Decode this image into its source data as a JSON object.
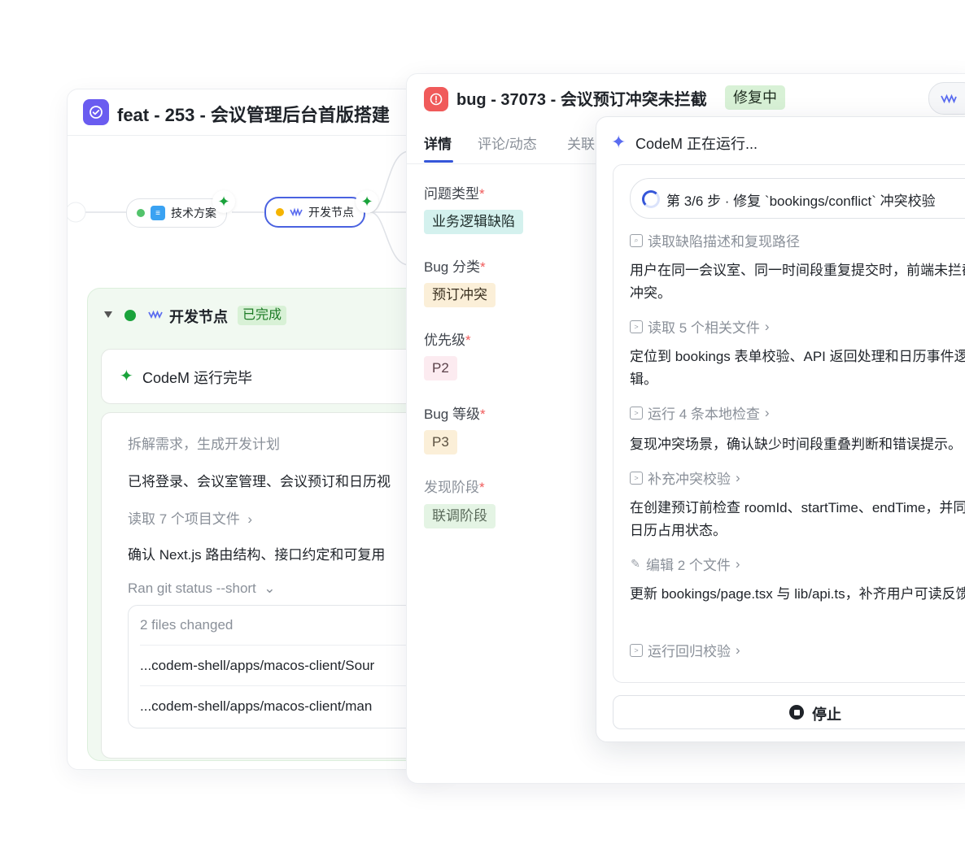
{
  "feat_panel": {
    "title": "feat - 253 - 会议管理后台首版搭建",
    "flow": {
      "node1_label": "技术方案",
      "node2_label": "开发节点"
    },
    "node_section": {
      "title": "开发节点",
      "status_tag": "已完成",
      "ran_text": "CodeM 运行完毕",
      "log": {
        "step_title": "拆解需求，生成开发计划",
        "line1": "已将登录、会议室管理、会议预订和日历视",
        "read_files": "读取 7 个项目文件",
        "line2": "确认 Next.js 路由结构、接口约定和可复用",
        "git_cmd": "Ran git status --short",
        "files_changed": "2 files changed",
        "file1": "...codem-shell/apps/macos-client/Sour",
        "file2": "...codem-shell/apps/macos-client/man"
      }
    }
  },
  "bug_panel": {
    "title": "bug - 37073 - 会议预订冲突未拦截",
    "status_tag": "修复中",
    "tabs": [
      "详情",
      "评论/动态",
      "关联"
    ],
    "fields": [
      {
        "label": "问题类型",
        "value": "业务逻辑缺陷"
      },
      {
        "label": "Bug 分类",
        "value": "预订冲突"
      },
      {
        "label": "优先级",
        "value": "P2"
      },
      {
        "label": "Bug 等级",
        "value": "P3"
      },
      {
        "label": "发现阶段",
        "value": "联调阶段"
      }
    ],
    "required_mark": "*"
  },
  "codem_panel": {
    "title": "CodeM 正在运行...",
    "step": "第 3/6 步 · 修复 `bookings/conflict` 冲突校验",
    "act1": "读取缺陷描述和复现路径",
    "para1": "用户在同一会议室、同一时间段重复提交时，前端未拦截冲突。",
    "act2": "读取 5 个相关文件",
    "para2": "定位到 bookings 表单校验、API 返回处理和日历事件逻辑。",
    "act3": "运行 4 条本地检查",
    "para3": "复现冲突场景，确认缺少时间段重叠判断和错误提示。",
    "act4": "补充冲突校验",
    "para4": "在创建预订前检查 roomId、startTime、endTime，并同步日历占用状态。",
    "act5": "编辑 2 个文件",
    "para5": "更新 bookings/page.tsx 与 lib/api.ts，补齐用户可读反馈。",
    "act6": "运行回归校验",
    "stop_label": "停止"
  },
  "colors": {
    "accent_purple": "#6a5cf0",
    "bug_red": "#f05a5a",
    "success_green": "#1aa33b",
    "link_blue": "#3556d9"
  }
}
